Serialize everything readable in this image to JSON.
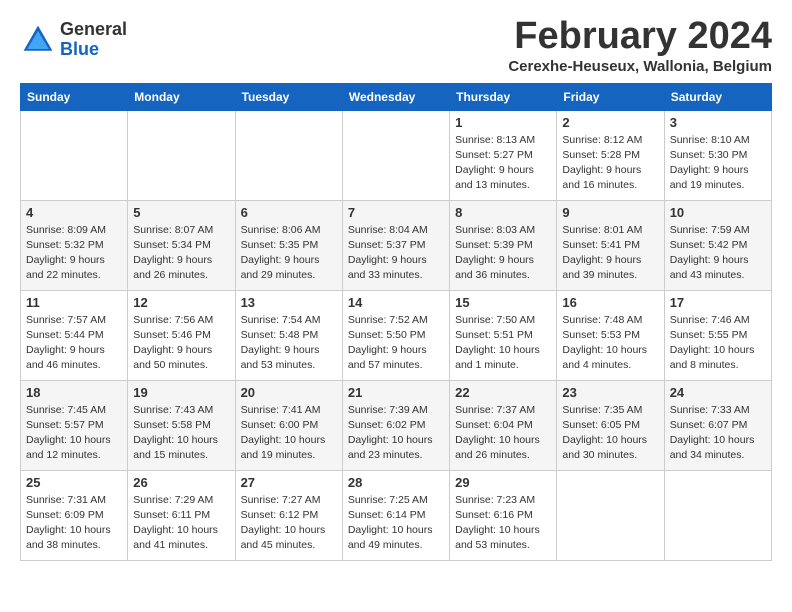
{
  "header": {
    "logo_general": "General",
    "logo_blue": "Blue",
    "month_title": "February 2024",
    "location": "Cerexhe-Heuseux, Wallonia, Belgium"
  },
  "weekdays": [
    "Sunday",
    "Monday",
    "Tuesday",
    "Wednesday",
    "Thursday",
    "Friday",
    "Saturday"
  ],
  "weeks": [
    [
      {
        "day": "",
        "info": ""
      },
      {
        "day": "",
        "info": ""
      },
      {
        "day": "",
        "info": ""
      },
      {
        "day": "",
        "info": ""
      },
      {
        "day": "1",
        "info": "Sunrise: 8:13 AM\nSunset: 5:27 PM\nDaylight: 9 hours\nand 13 minutes."
      },
      {
        "day": "2",
        "info": "Sunrise: 8:12 AM\nSunset: 5:28 PM\nDaylight: 9 hours\nand 16 minutes."
      },
      {
        "day": "3",
        "info": "Sunrise: 8:10 AM\nSunset: 5:30 PM\nDaylight: 9 hours\nand 19 minutes."
      }
    ],
    [
      {
        "day": "4",
        "info": "Sunrise: 8:09 AM\nSunset: 5:32 PM\nDaylight: 9 hours\nand 22 minutes."
      },
      {
        "day": "5",
        "info": "Sunrise: 8:07 AM\nSunset: 5:34 PM\nDaylight: 9 hours\nand 26 minutes."
      },
      {
        "day": "6",
        "info": "Sunrise: 8:06 AM\nSunset: 5:35 PM\nDaylight: 9 hours\nand 29 minutes."
      },
      {
        "day": "7",
        "info": "Sunrise: 8:04 AM\nSunset: 5:37 PM\nDaylight: 9 hours\nand 33 minutes."
      },
      {
        "day": "8",
        "info": "Sunrise: 8:03 AM\nSunset: 5:39 PM\nDaylight: 9 hours\nand 36 minutes."
      },
      {
        "day": "9",
        "info": "Sunrise: 8:01 AM\nSunset: 5:41 PM\nDaylight: 9 hours\nand 39 minutes."
      },
      {
        "day": "10",
        "info": "Sunrise: 7:59 AM\nSunset: 5:42 PM\nDaylight: 9 hours\nand 43 minutes."
      }
    ],
    [
      {
        "day": "11",
        "info": "Sunrise: 7:57 AM\nSunset: 5:44 PM\nDaylight: 9 hours\nand 46 minutes."
      },
      {
        "day": "12",
        "info": "Sunrise: 7:56 AM\nSunset: 5:46 PM\nDaylight: 9 hours\nand 50 minutes."
      },
      {
        "day": "13",
        "info": "Sunrise: 7:54 AM\nSunset: 5:48 PM\nDaylight: 9 hours\nand 53 minutes."
      },
      {
        "day": "14",
        "info": "Sunrise: 7:52 AM\nSunset: 5:50 PM\nDaylight: 9 hours\nand 57 minutes."
      },
      {
        "day": "15",
        "info": "Sunrise: 7:50 AM\nSunset: 5:51 PM\nDaylight: 10 hours\nand 1 minute."
      },
      {
        "day": "16",
        "info": "Sunrise: 7:48 AM\nSunset: 5:53 PM\nDaylight: 10 hours\nand 4 minutes."
      },
      {
        "day": "17",
        "info": "Sunrise: 7:46 AM\nSunset: 5:55 PM\nDaylight: 10 hours\nand 8 minutes."
      }
    ],
    [
      {
        "day": "18",
        "info": "Sunrise: 7:45 AM\nSunset: 5:57 PM\nDaylight: 10 hours\nand 12 minutes."
      },
      {
        "day": "19",
        "info": "Sunrise: 7:43 AM\nSunset: 5:58 PM\nDaylight: 10 hours\nand 15 minutes."
      },
      {
        "day": "20",
        "info": "Sunrise: 7:41 AM\nSunset: 6:00 PM\nDaylight: 10 hours\nand 19 minutes."
      },
      {
        "day": "21",
        "info": "Sunrise: 7:39 AM\nSunset: 6:02 PM\nDaylight: 10 hours\nand 23 minutes."
      },
      {
        "day": "22",
        "info": "Sunrise: 7:37 AM\nSunset: 6:04 PM\nDaylight: 10 hours\nand 26 minutes."
      },
      {
        "day": "23",
        "info": "Sunrise: 7:35 AM\nSunset: 6:05 PM\nDaylight: 10 hours\nand 30 minutes."
      },
      {
        "day": "24",
        "info": "Sunrise: 7:33 AM\nSunset: 6:07 PM\nDaylight: 10 hours\nand 34 minutes."
      }
    ],
    [
      {
        "day": "25",
        "info": "Sunrise: 7:31 AM\nSunset: 6:09 PM\nDaylight: 10 hours\nand 38 minutes."
      },
      {
        "day": "26",
        "info": "Sunrise: 7:29 AM\nSunset: 6:11 PM\nDaylight: 10 hours\nand 41 minutes."
      },
      {
        "day": "27",
        "info": "Sunrise: 7:27 AM\nSunset: 6:12 PM\nDaylight: 10 hours\nand 45 minutes."
      },
      {
        "day": "28",
        "info": "Sunrise: 7:25 AM\nSunset: 6:14 PM\nDaylight: 10 hours\nand 49 minutes."
      },
      {
        "day": "29",
        "info": "Sunrise: 7:23 AM\nSunset: 6:16 PM\nDaylight: 10 hours\nand 53 minutes."
      },
      {
        "day": "",
        "info": ""
      },
      {
        "day": "",
        "info": ""
      }
    ]
  ]
}
